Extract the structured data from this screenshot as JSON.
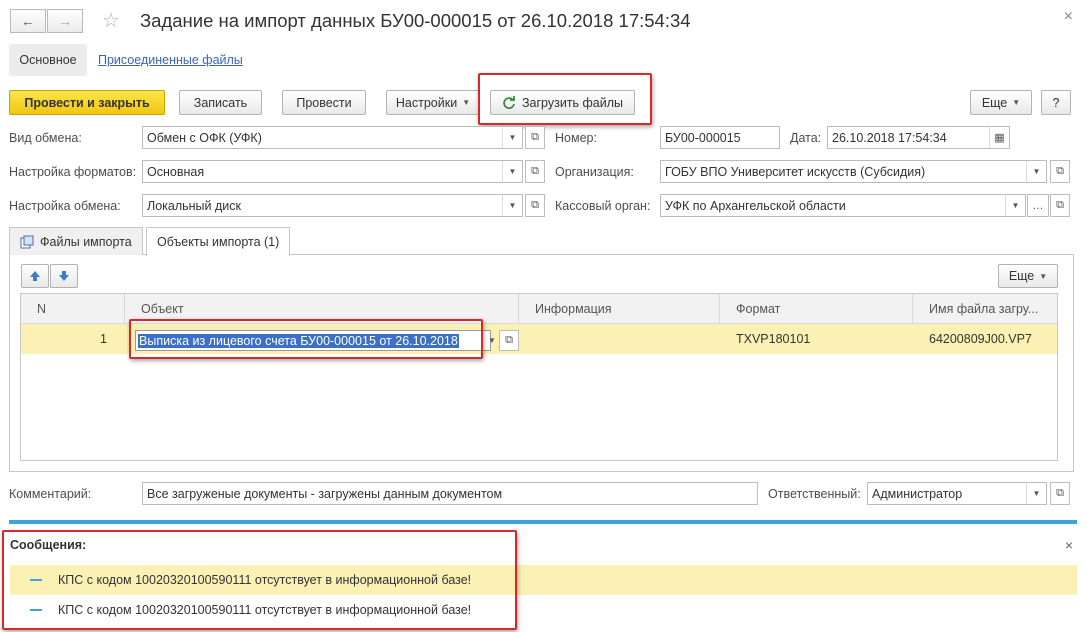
{
  "window": {
    "title": "Задание на импорт данных БУ00-000015 от 26.10.2018 17:54:34",
    "close_glyph": "×"
  },
  "nav": {
    "back": "←",
    "forward": "→",
    "star": "☆"
  },
  "top_tabs": {
    "main": "Основное",
    "attached": "Присоединенные файлы"
  },
  "toolbar": {
    "post_close": "Провести и закрыть",
    "save": "Записать",
    "post": "Провести",
    "settings": "Настройки",
    "load_files": "Загрузить файлы",
    "more": "Еще",
    "help": "?"
  },
  "form": {
    "exchange_type": {
      "label": "Вид обмена:",
      "value": "Обмен с ОФК (УФК)"
    },
    "format_settings": {
      "label": "Настройка форматов:",
      "value": "Основная"
    },
    "exchange_settings": {
      "label": "Настройка обмена:",
      "value": "Локальный диск"
    },
    "number": {
      "label": "Номер:",
      "value": "БУ00-000015"
    },
    "date": {
      "label": "Дата:",
      "value": "26.10.2018 17:54:34"
    },
    "organization": {
      "label": "Организация:",
      "value": "ГОБУ ВПО Университет искусств (Субсидия)"
    },
    "cash_authority": {
      "label": "Кассовый орган:",
      "value": "УФК по Архангельской области"
    }
  },
  "section_tabs": {
    "files": "Файлы импорта",
    "objects": "Объекты импорта (1)"
  },
  "table": {
    "more": "Еще",
    "columns": [
      "N",
      "Объект",
      "Информация",
      "Формат",
      "Имя файла загру..."
    ],
    "rows": [
      {
        "n": "1",
        "object": "Выписка из лицевого счета БУ00-000015 от 26.10.2018",
        "info": "",
        "format": "TXVP180101",
        "file": "64200809J00.VP7"
      }
    ]
  },
  "footer": {
    "comment": {
      "label": "Комментарий:",
      "value": "Все загруженые документы - загружены данным документом"
    },
    "responsible": {
      "label": "Ответственный:",
      "value": "Администратор"
    }
  },
  "messages": {
    "title": "Сообщения:",
    "items": [
      "КПС с кодом 10020320100590111 отсутствует в информационной базе!",
      "КПС с кодом 10020320100590111 отсутствует в информационной базе!"
    ]
  },
  "colors": {
    "primary_button": "#f1c611",
    "highlight_row": "#fbf1b4",
    "annotation_red": "#d82828",
    "message_accent": "#3fa3d8",
    "link": "#3b64b5"
  }
}
